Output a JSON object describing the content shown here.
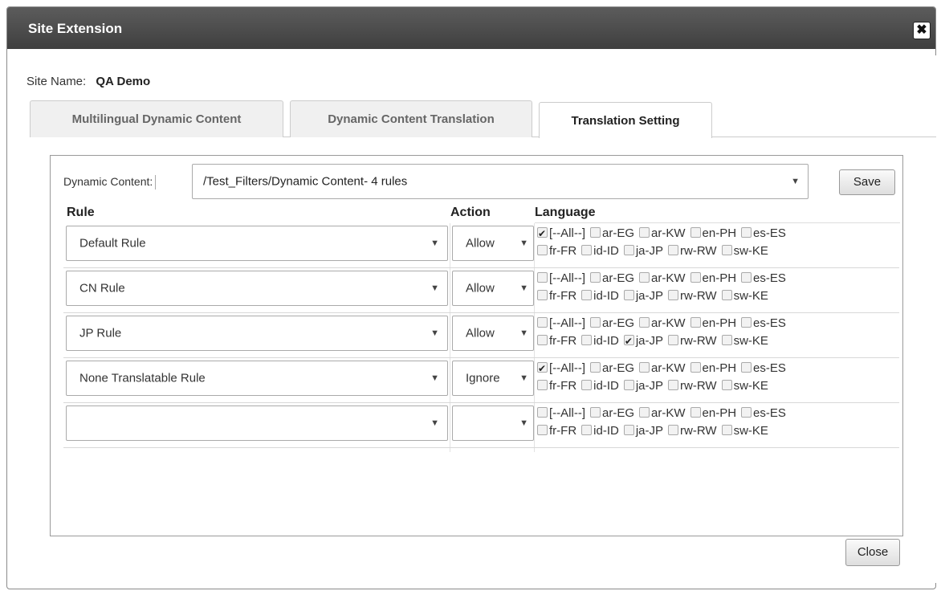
{
  "dialog": {
    "title": "Site Extension",
    "close_icon_symbol": "✖"
  },
  "site": {
    "label": "Site Name:",
    "value": "QA Demo"
  },
  "tabs": [
    {
      "label": "Multilingual Dynamic Content",
      "active": false
    },
    {
      "label": "Dynamic Content Translation",
      "active": false
    },
    {
      "label": "Translation Setting",
      "active": true
    }
  ],
  "dynamic_content": {
    "label": "Dynamic Content:",
    "value": "/Test_Filters/Dynamic Content- 4 rules",
    "save_label": "Save"
  },
  "columns": {
    "rule": "Rule",
    "action": "Action",
    "language": "Language"
  },
  "languages": [
    "[--All--]",
    "ar-EG",
    "ar-KW",
    "en-PH",
    "es-ES",
    "fr-FR",
    "id-ID",
    "ja-JP",
    "rw-RW",
    "sw-KE"
  ],
  "rows": [
    {
      "rule": "Default Rule",
      "action": "Allow",
      "checked": [
        "[--All--]"
      ]
    },
    {
      "rule": "CN Rule",
      "action": "Allow",
      "checked": []
    },
    {
      "rule": "JP Rule",
      "action": "Allow",
      "checked": [
        "ja-JP"
      ]
    },
    {
      "rule": "None Translatable Rule",
      "action": "Ignore",
      "checked": [
        "[--All--]"
      ]
    },
    {
      "rule": "",
      "action": "",
      "checked": []
    }
  ],
  "footer": {
    "close_label": "Close"
  },
  "colors": {
    "titlebar": "#4a4a4a",
    "panel_border": "#9a9a9a"
  }
}
